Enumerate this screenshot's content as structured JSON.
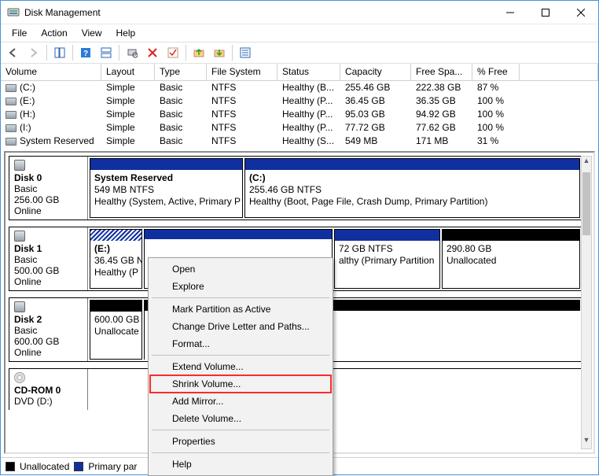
{
  "title": "Disk Management",
  "menus": {
    "file": "File",
    "action": "Action",
    "view": "View",
    "help": "Help"
  },
  "columns": {
    "volume": "Volume",
    "layout": "Layout",
    "type": "Type",
    "fs": "File System",
    "status": "Status",
    "capacity": "Capacity",
    "free": "Free Spa...",
    "pct": "% Free"
  },
  "col_widths": {
    "volume": 128,
    "layout": 68,
    "type": 66,
    "fs": 90,
    "status": 80,
    "capacity": 90,
    "free": 78,
    "pct": 60
  },
  "volumes": [
    {
      "name": "(C:)",
      "layout": "Simple",
      "type": "Basic",
      "fs": "NTFS",
      "status": "Healthy (B...",
      "capacity": "255.46 GB",
      "free": "222.38 GB",
      "pct": "87 %"
    },
    {
      "name": "(E:)",
      "layout": "Simple",
      "type": "Basic",
      "fs": "NTFS",
      "status": "Healthy (P...",
      "capacity": "36.45 GB",
      "free": "36.35 GB",
      "pct": "100 %"
    },
    {
      "name": "(H:)",
      "layout": "Simple",
      "type": "Basic",
      "fs": "NTFS",
      "status": "Healthy (P...",
      "capacity": "95.03 GB",
      "free": "94.92 GB",
      "pct": "100 %"
    },
    {
      "name": "(I:)",
      "layout": "Simple",
      "type": "Basic",
      "fs": "NTFS",
      "status": "Healthy (P...",
      "capacity": "77.72 GB",
      "free": "77.62 GB",
      "pct": "100 %"
    },
    {
      "name": "System Reserved",
      "layout": "Simple",
      "type": "Basic",
      "fs": "NTFS",
      "status": "Healthy (S...",
      "capacity": "549 MB",
      "free": "171 MB",
      "pct": "31 %"
    }
  ],
  "disks": {
    "d0": {
      "name": "Disk 0",
      "type": "Basic",
      "size": "256.00 GB",
      "state": "Online",
      "parts": {
        "p0": {
          "title": "System Reserved",
          "line2": "549 MB NTFS",
          "line3": "Healthy (System, Active, Primary P"
        },
        "p1": {
          "title": "(C:)",
          "line2": "255.46 GB NTFS",
          "line3": "Healthy (Boot, Page File, Crash Dump, Primary Partition)"
        }
      }
    },
    "d1": {
      "name": "Disk 1",
      "type": "Basic",
      "size": "500.00 GB",
      "state": "Online",
      "parts": {
        "p0": {
          "title": "(E:)",
          "line2": "36.45 GB N",
          "line3": "Healthy (P"
        },
        "p1": {
          "title": "",
          "line2": "72 GB NTFS",
          "line3": "althy (Primary Partition"
        },
        "p2": {
          "title": "",
          "line2": "290.80 GB",
          "line3": "Unallocated"
        }
      }
    },
    "d2": {
      "name": "Disk 2",
      "type": "Basic",
      "size": "600.00 GB",
      "state": "Online",
      "parts": {
        "p0": {
          "title": "",
          "line2": "600.00 GB",
          "line3": "Unallocate"
        }
      }
    },
    "cd": {
      "name": "CD-ROM 0",
      "sub": "DVD (D:)"
    }
  },
  "legend": {
    "unalloc": "Unallocated",
    "primary": "Primary par"
  },
  "context_menu": {
    "open": "Open",
    "explore": "Explore",
    "mark_active": "Mark Partition as Active",
    "change_letter": "Change Drive Letter and Paths...",
    "format": "Format...",
    "extend": "Extend Volume...",
    "shrink": "Shrink Volume...",
    "add_mirror": "Add Mirror...",
    "delete": "Delete Volume...",
    "properties": "Properties",
    "help": "Help"
  }
}
